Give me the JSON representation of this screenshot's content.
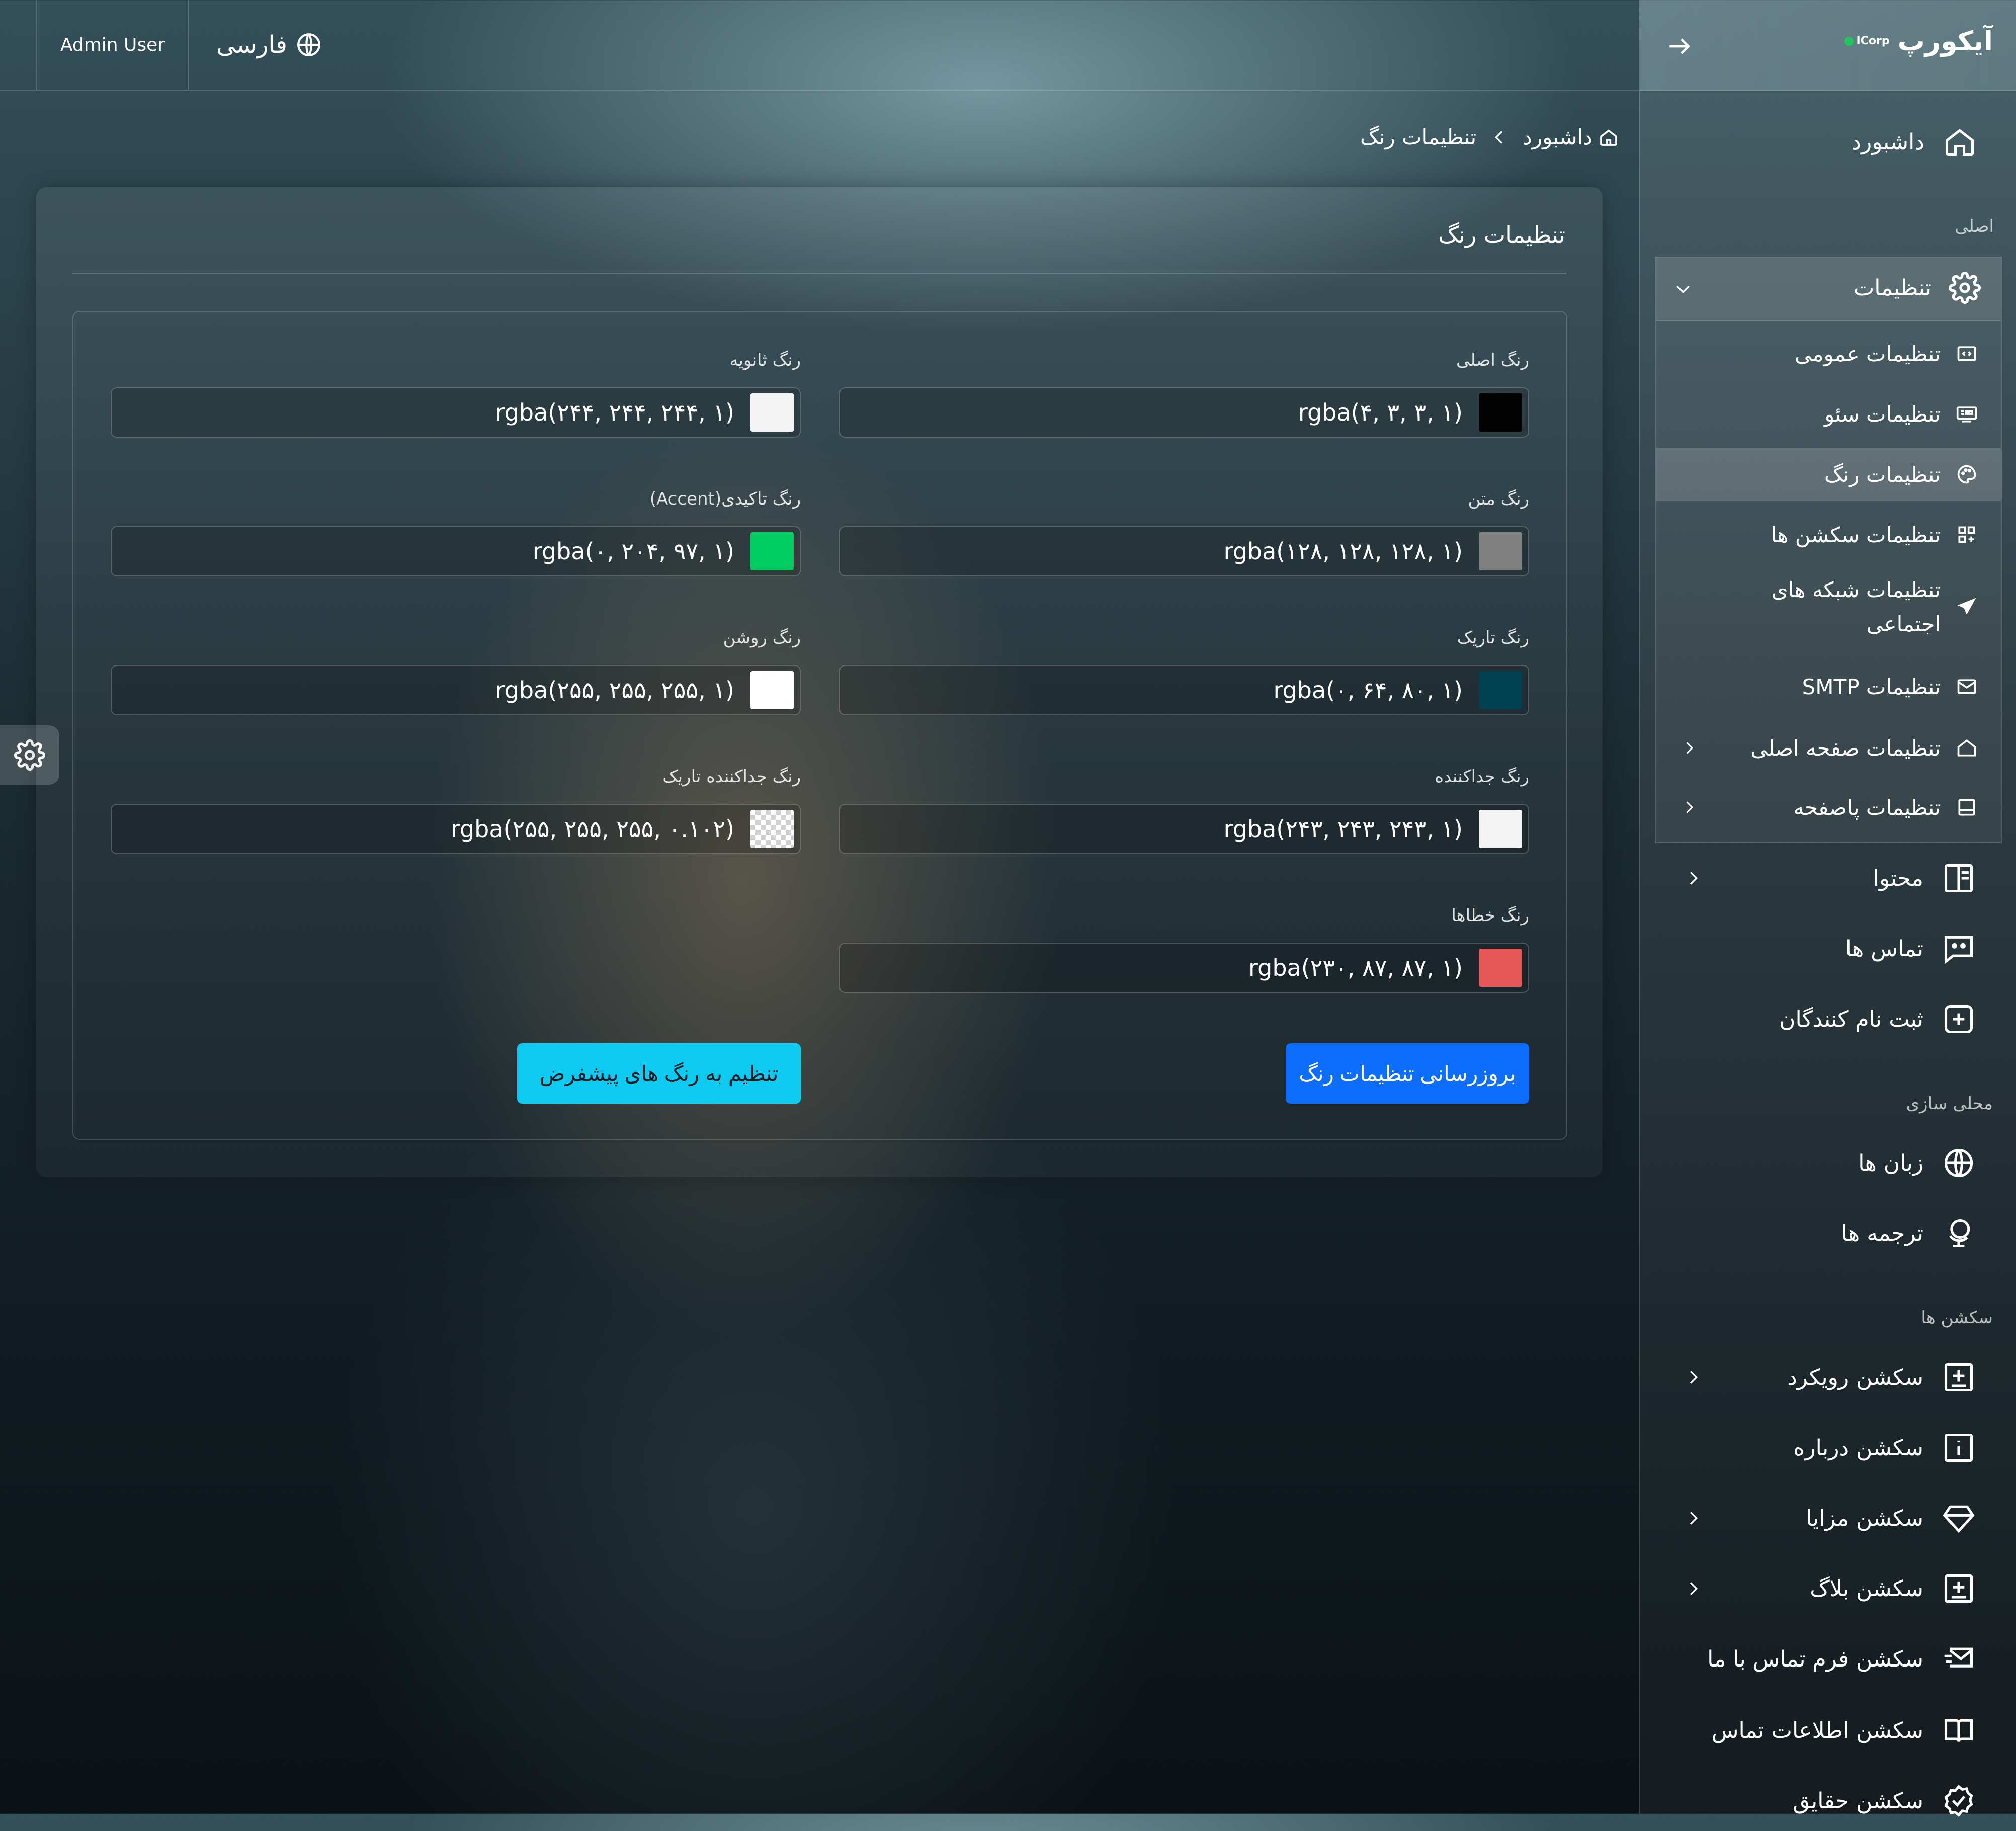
{
  "header": {
    "user_name": "Admin User",
    "language": "فارسی",
    "language_icon": "globe-icon"
  },
  "sidebar": {
    "logo_title": "آیکورپ",
    "logo_badge": "ICorp",
    "collapse_icon": "arrow-right-icon",
    "dashboard": "داشبورد",
    "section_main": "اصلی",
    "settings": {
      "label": "تنظیمات",
      "items": [
        {
          "label": "تنظیمات عمومی",
          "icon": "code-window-icon"
        },
        {
          "label": "تنظیمات سئو",
          "icon": "seo-icon"
        },
        {
          "label": "تنظیمات رنگ",
          "icon": "palette-icon",
          "active": true
        },
        {
          "label": "تنظیمات سکشن ها",
          "icon": "grid-icon"
        },
        {
          "label": "تنظیمات شبکه های",
          "label_line2": "اجتماعی",
          "icon": "send-icon"
        },
        {
          "label": "تنظیمات SMTP",
          "icon": "mail-icon"
        },
        {
          "label": "تنظیمات صفحه اصلی",
          "icon": "home-icon",
          "has_children": true
        },
        {
          "label": "تنظیمات پاصفحه",
          "icon": "footer-icon",
          "has_children": true
        }
      ]
    },
    "content": "محتوا",
    "contacts": "تماس ها",
    "registrants": "ثبت نام کنندگان",
    "section_localization": "محلی سازی",
    "languages": "زبان ها",
    "translations": "ترجمه ها",
    "section_sections": "سکشن ها",
    "sections": [
      {
        "label": "سکشن رویکرد",
        "icon": "plus-square-icon",
        "has_children": true
      },
      {
        "label": "سکشن درباره",
        "icon": "info-square-icon",
        "has_children": false
      },
      {
        "label": "سکشن مزایا",
        "icon": "diamond-icon",
        "has_children": true
      },
      {
        "label": "سکشن بلاگ",
        "icon": "plus-square-icon",
        "has_children": true
      },
      {
        "label": "سکشن فرم تماس با ما",
        "icon": "mail-send-icon",
        "has_children": false
      },
      {
        "label": "سکشن اطلاعات تماس",
        "icon": "book-icon",
        "has_children": false
      },
      {
        "label": "سکشن حقایق",
        "icon": "badge-check-icon",
        "has_children": false
      }
    ]
  },
  "breadcrumb": {
    "home": "داشبورد",
    "current": "تنظیمات رنگ"
  },
  "card": {
    "title": "تنظیمات رنگ"
  },
  "fields": [
    {
      "label": "رنگ اصلی",
      "value": "rgba(۴, ۳, ۳, ۱)",
      "color": "#040303"
    },
    {
      "label": "رنگ ثانویه",
      "value": "rgba(۲۴۴, ۲۴۴, ۲۴۴, ۱)",
      "color": "#f4f4f4"
    },
    {
      "label": "رنگ متن",
      "value": "rgba(۱۲۸, ۱۲۸, ۱۲۸, ۱)",
      "color": "#808080"
    },
    {
      "label": "رنگ تاکیدی(Accent)",
      "value": "rgba(۰, ۲۰۴, ۹۷, ۱)",
      "color": "#00cc61"
    },
    {
      "label": "رنگ تاریک",
      "value": "rgba(۰, ۶۴, ۸۰, ۱)",
      "color": "#004050"
    },
    {
      "label": "رنگ روشن",
      "value": "rgba(۲۵۵, ۲۵۵, ۲۵۵, ۱)",
      "color": "#ffffff"
    },
    {
      "label": "رنگ جداکننده",
      "value": "rgba(۲۴۳, ۲۴۳, ۲۴۳, ۱)",
      "color": "#f3f3f3"
    },
    {
      "label": "رنگ جداکننده تاریک",
      "value": "rgba(۲۵۵, ۲۵۵, ۲۵۵, ۰.۱۰۲)",
      "color": "rgba(255,255,255,0.102)"
    },
    {
      "label": "رنگ خطاها",
      "value": "rgba(۲۳۰, ۸۷, ۸۷, ۱)",
      "color": "#e65757"
    }
  ],
  "buttons": {
    "update": "بروزرسانی تنظیمات رنگ",
    "update_color": "#0d6efd",
    "reset": "تنظیم به رنگ های پیشفرض",
    "reset_color": "#0dcaf0"
  }
}
